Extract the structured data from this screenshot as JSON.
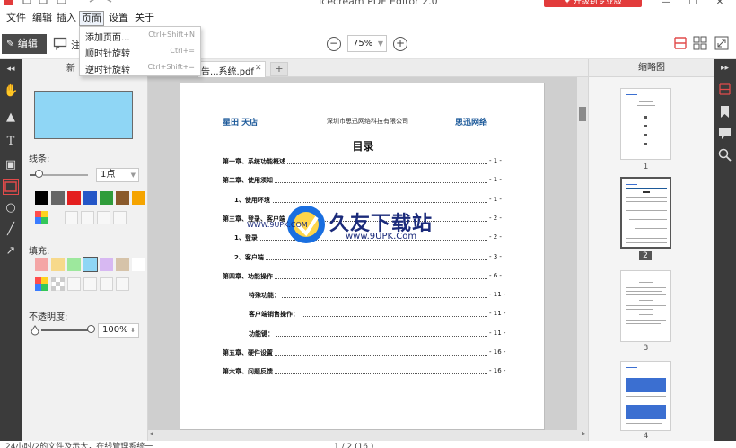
{
  "window": {
    "title": "Icecream PDF Editor 2.0",
    "upgrade_label": "✦ 升级到专业版",
    "minimize": "—",
    "maximize": "☐",
    "close": "✕"
  },
  "menu": {
    "items": [
      "文件",
      "编辑",
      "插入",
      "页面",
      "设置",
      "关于"
    ],
    "active": "页面",
    "dropdown": [
      {
        "label": "添加页面...",
        "shortcut": "Ctrl+Shift+N"
      },
      {
        "label": "顺时针旋转",
        "shortcut": "Ctrl+="
      },
      {
        "label": "逆时针旋转",
        "shortcut": "Ctrl+Shift+="
      }
    ]
  },
  "toolbar": {
    "edit_label": "编辑",
    "comment_partial": "注",
    "zoom_value": "75%",
    "zoom_out": "−",
    "zoom_in": "+"
  },
  "props": {
    "stroke_label": "线条:",
    "stroke_width": "1点",
    "fill_label": "填充:",
    "opacity_label": "不透明度:",
    "opacity_value": "100%",
    "stroke_colors": [
      "#000000",
      "#666666",
      "#e41f1f",
      "#2456c7",
      "#2f9c3a",
      "#8a5a2b",
      "#f5a400"
    ],
    "fill_colors": [
      "#f4a6a6",
      "#f7d98b",
      "#9de89d",
      "#8fd6f5",
      "#d7b8f2",
      "#d6c3a9",
      "#ffffff"
    ],
    "preview_fill": "#8fd6f5"
  },
  "tabs": {
    "left_partial": "新",
    "doc_name": "...系统.pdf",
    "doc_prefix": "告",
    "add": "+"
  },
  "document": {
    "logo_left": "星田 天店",
    "company": "深圳市思迅网络科技有限公司",
    "logo_right": "思迅网络",
    "toc_title": "目录",
    "toc": [
      {
        "title": "第一章、系统功能概述",
        "page": "- 1 -",
        "level": 0
      },
      {
        "title": "第二章、使用须知",
        "page": "- 1 -",
        "level": 0
      },
      {
        "title": "1、使用环境",
        "page": "- 1 -",
        "level": 1
      },
      {
        "title": "第三章、登录、客户端",
        "page": "- 2 -",
        "level": 0
      },
      {
        "title": "1、登录",
        "page": "- 2 -",
        "level": 1
      },
      {
        "title": "2、客户端",
        "page": "- 3 -",
        "level": 1
      },
      {
        "title": "第四章、功能操作",
        "page": "- 6 -",
        "level": 0
      },
      {
        "title": "特殊功能：",
        "page": "- 11 -",
        "level": 2
      },
      {
        "title": "客户端销售操作：",
        "page": "- 11 -",
        "level": 2
      },
      {
        "title": "功能键：",
        "page": "- 11 -",
        "level": 2
      },
      {
        "title": "第五章、硬件设置",
        "page": "- 16 -",
        "level": 0
      },
      {
        "title": "第六章、问题反馈",
        "page": "- 16 -",
        "level": 0
      }
    ],
    "watermark_text": "久友下载站",
    "watermark_url": "www.9UPK.Com",
    "watermark_small": "WWW.9UPK.COM"
  },
  "thumbnails": {
    "header": "缩略图",
    "pages": [
      "1",
      "2",
      "3",
      "4"
    ],
    "selected": "2"
  },
  "status": {
    "left": "24小时/2的文件及示大，在线管理系统一",
    "page_info": "1 / 2 (16 )"
  }
}
